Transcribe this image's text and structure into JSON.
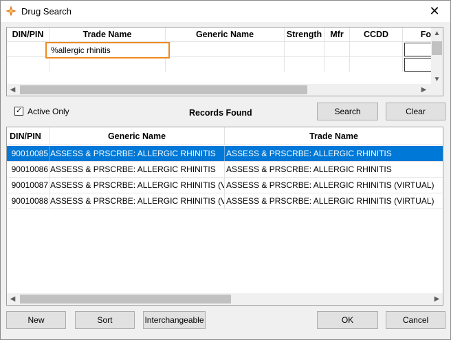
{
  "window": {
    "title": "Drug Search",
    "close_glyph": "✕"
  },
  "search_grid": {
    "columns": [
      "DIN/PIN",
      "Trade Name",
      "Generic Name",
      "Strength",
      "Mfr",
      "CCDD",
      "Fo"
    ],
    "trade_name_value": "%allergic rhinitis"
  },
  "controls": {
    "active_only_label": "Active Only",
    "active_only_checked": "✓",
    "records_found_label": "Records Found",
    "search_label": "Search",
    "clear_label": "Clear"
  },
  "results": {
    "columns": [
      "DIN/PIN",
      "Generic Name",
      "Trade Name"
    ],
    "rows": [
      {
        "din": "90010085",
        "generic": "ASSESS & PRSCRBE: ALLERGIC RHINITIS",
        "trade": "ASSESS & PRSCRBE: ALLERGIC RHINITIS"
      },
      {
        "din": "90010086",
        "generic": "ASSESS & PRSCRBE: ALLERGIC RHINITIS",
        "trade": "ASSESS & PRSCRBE: ALLERGIC RHINITIS"
      },
      {
        "din": "90010087",
        "generic": "ASSESS & PRSCRBE: ALLERGIC RHINITIS (VIRTUAL)",
        "trade": "ASSESS & PRSCRBE: ALLERGIC RHINITIS (VIRTUAL)"
      },
      {
        "din": "90010088",
        "generic": "ASSESS & PRSCRBE: ALLERGIC RHINITIS (VIRTUAL)",
        "trade": "ASSESS & PRSCRBE: ALLERGIC RHINITIS (VIRTUAL)"
      }
    ]
  },
  "footer": {
    "new_label": "New",
    "sort_label": "Sort",
    "interchangeable_label": "Interchangeable",
    "ok_label": "OK",
    "cancel_label": "Cancel"
  },
  "icons": {
    "app": "drug-search-app-icon",
    "scroll_left": "◀",
    "scroll_right": "▶",
    "scroll_up": "▲",
    "scroll_down": "▼"
  },
  "colors": {
    "selection": "#0078d7",
    "input_highlight": "#ee8a1f"
  }
}
